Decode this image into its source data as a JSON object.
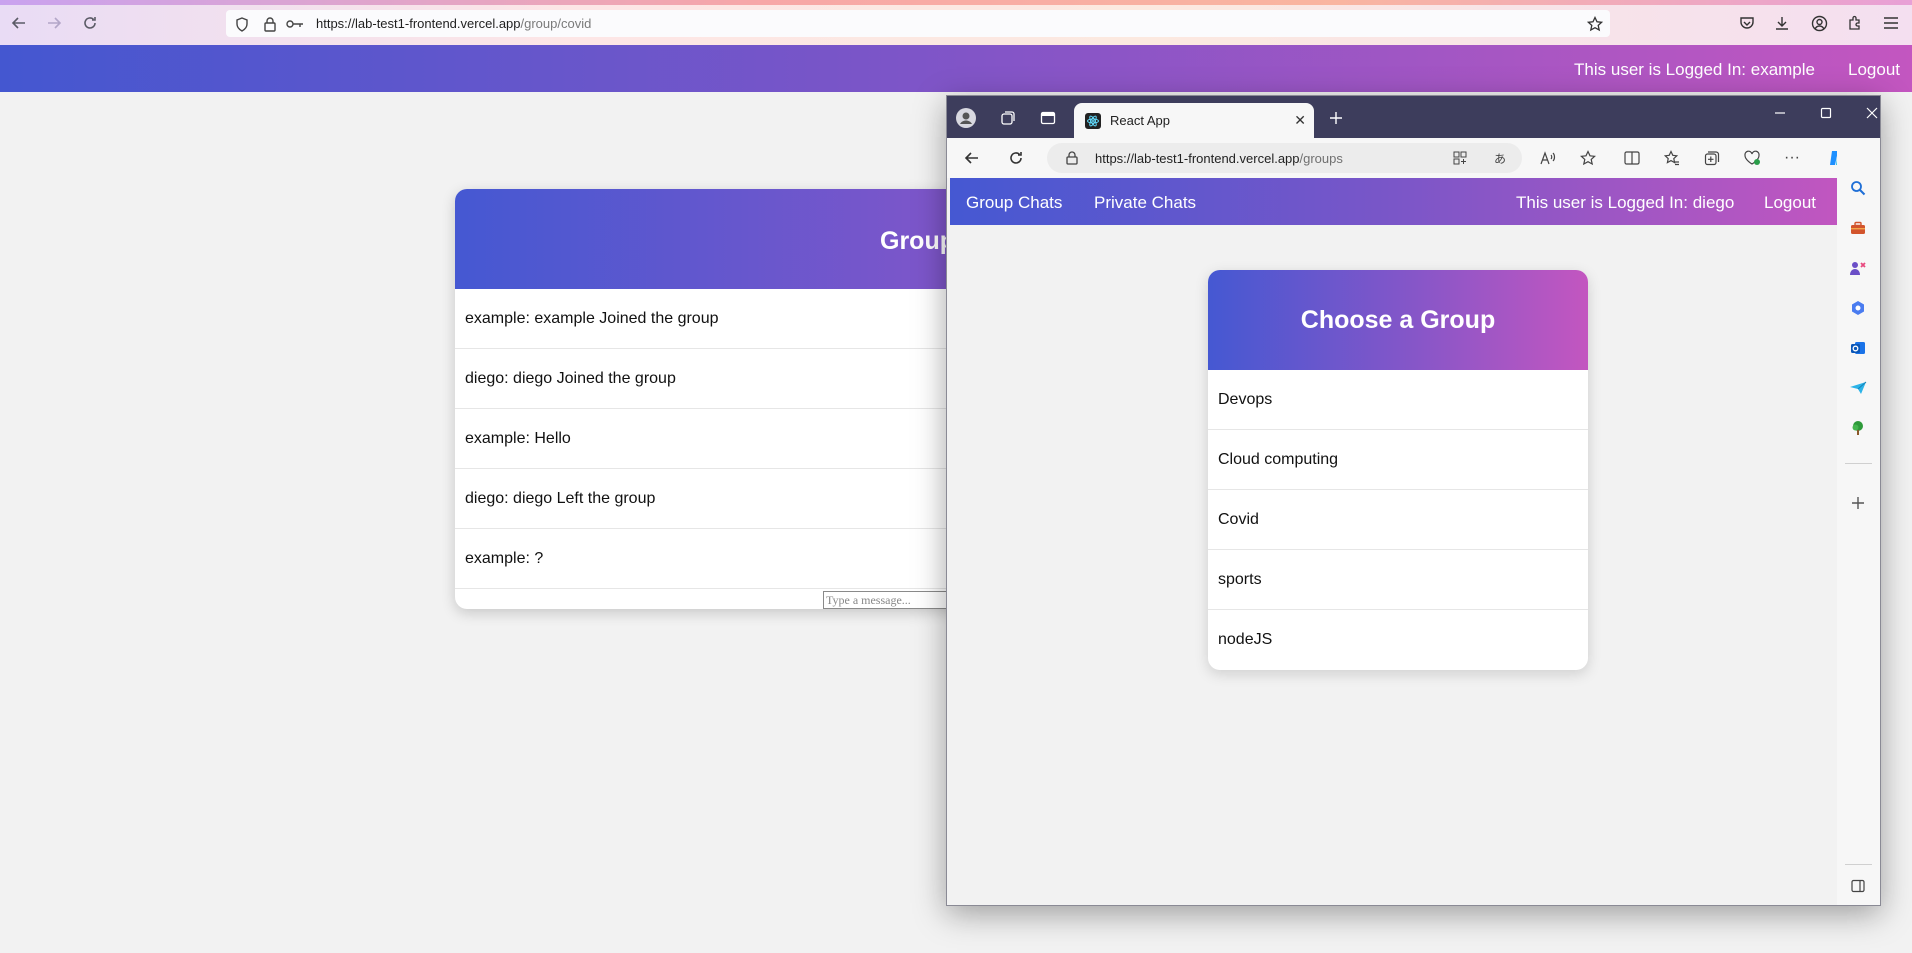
{
  "firefox": {
    "url_host": "https://lab-test1-frontend.vercel.app",
    "url_path": "/group/covid"
  },
  "back_app": {
    "user_status": "This user is Logged In: example",
    "logout": "Logout",
    "chat_title": "Group",
    "messages": [
      "example: example Joined the group",
      "diego: diego Joined the group",
      "example: Hello",
      "diego: diego Left the group",
      "example: ?"
    ],
    "input_placeholder": "Type a message..."
  },
  "edge": {
    "tab_title": "React App",
    "url_host": "https://lab-test1-frontend.vercel.app",
    "url_path": "/groups"
  },
  "front_app": {
    "nav_group_chats": "Group Chats",
    "nav_private_chats": "Private Chats",
    "user_status": "This user is Logged In: diego",
    "logout": "Logout",
    "card_title": "Choose a Group",
    "groups": [
      "Devops",
      "Cloud computing",
      "Covid",
      "sports",
      "nodeJS"
    ]
  }
}
